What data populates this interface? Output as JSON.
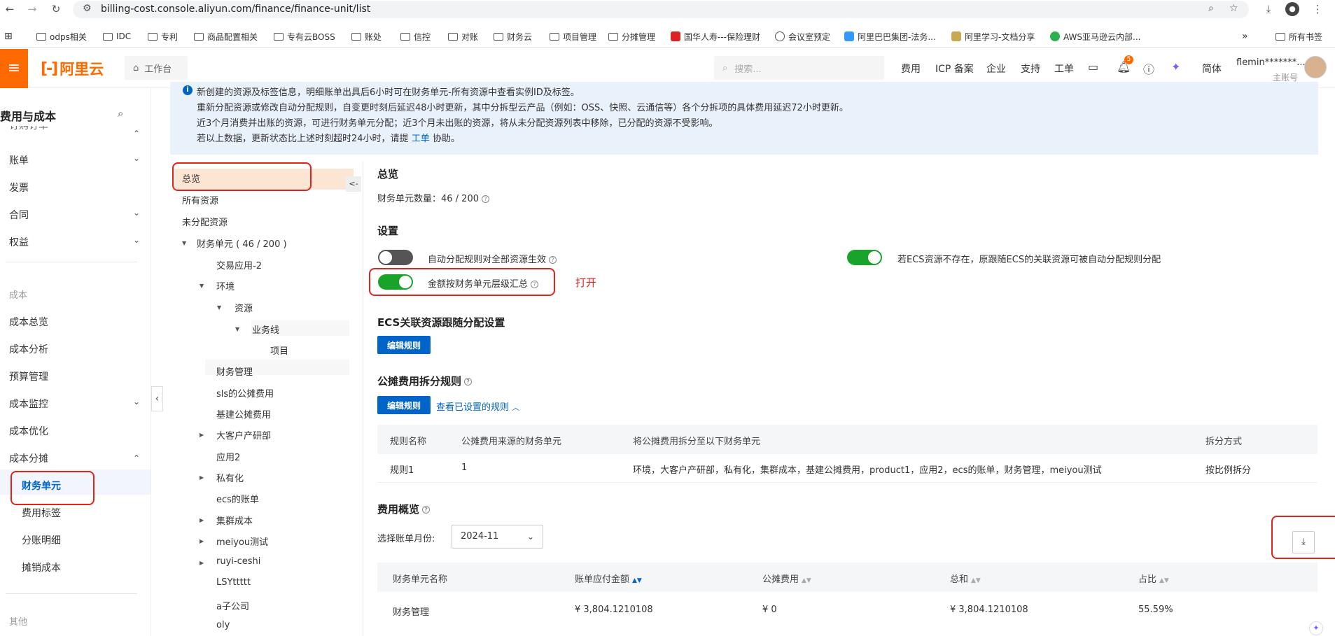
{
  "browser": {
    "url": "billing-cost.console.aliyun.com/finance/finance-unit/list",
    "bookmarks": [
      "odps相关",
      "IDC",
      "专利",
      "商品配置相关",
      "专有云BOSS",
      "账处",
      "信控",
      "对账",
      "财务云",
      "项目管理",
      "分摊管理",
      "国华人寿---保险理财",
      "会议室预定",
      "阿里巴巴集团-法务...",
      "阿里学习-文档分享",
      "AWS亚马逊云内部..."
    ],
    "all_bookmarks": "所有书签",
    "more": "»"
  },
  "topbar": {
    "logo_text": "阿里云",
    "workbench": "工作台",
    "search_placeholder": "搜索...",
    "nav": [
      "费用",
      "ICP 备案",
      "企业",
      "支持",
      "工单"
    ],
    "notif_count": "5",
    "lang": "简体",
    "username": "flemin*******...",
    "user_role": "主账号",
    "brand_color": "#ff6a00"
  },
  "sidebar": {
    "title": "费用与成本",
    "truncated_top": "订购订单",
    "items_top": [
      "账单",
      "发票",
      "合同",
      "权益"
    ],
    "group_cost": "成本",
    "items_cost": [
      "成本总览",
      "成本分析",
      "预算管理",
      "成本监控",
      "成本优化",
      "成本分摊"
    ],
    "sub_items": [
      "财务单元",
      "费用标签",
      "分账明细",
      "摊销成本"
    ],
    "group_other": "其他"
  },
  "notice": {
    "lines": [
      "新创建的资源及标签信息，明细账单出具后6小时可在财务单元-所有资源中查看实例ID及标签。",
      "重新分配资源或修改自动分配规则，自变更时刻后延迟48小时更新，其中分拆型云产品（例如：OSS、快照、云通信等）各个分拆项的具体费用延迟72小时更新。",
      "近3个月消费并出账的资源，可进行财务单元分配；近3个月未出账的资源，将从未分配资源列表中移除，已分配的资源不受影响。",
      "若以上数据，更新状态比上述时刻超时24小时，请提"
    ],
    "link": "工单",
    "tail": "协助。"
  },
  "tree": {
    "overview": "总览",
    "all_resources": "所有资源",
    "unallocated": "未分配资源",
    "root": "财务单元 ( 46 / 200 )",
    "nodes": [
      "交易应用-2",
      "环境",
      "资源",
      "业务线",
      "项目",
      "财务管理",
      "sls的公摊费用",
      "基建公摊费用",
      "大客户产研部",
      "应用2",
      "私有化",
      "ecs的账单",
      "集群成本",
      "meiyou测试",
      "ruyi-ceshi",
      "LSYttttt",
      "a子公司",
      "oly"
    ],
    "collapse": "<-"
  },
  "main": {
    "overview_title": "总览",
    "unit_count_label": "财务单元数量：46 / 200",
    "settings_title": "设置",
    "setting1": "自动分配规则对全部资源生效",
    "setting1_on": false,
    "setting2": "若ECS资源不存在，原跟随ECS的关联资源可被自动分配规则分配",
    "setting2_on": true,
    "setting3": "金额按财务单元层级汇总",
    "setting3_on": true,
    "annotation": "打开",
    "ecs_title": "ECS关联资源跟随分配设置",
    "edit_rule": "编辑规则",
    "split_title": "公摊费用拆分规则",
    "view_rules": "查看已设置的规则",
    "split_table": {
      "headers": [
        "规则名称",
        "公摊费用来源的财务单元",
        "将公摊费用拆分至以下财务单元",
        "拆分方式"
      ],
      "rows": [
        [
          "规则1",
          "1",
          "环境，大客户产研部，私有化，集群成本，基建公摊费用，product1，应用2，ecs的账单，财务管理，meiyou测试",
          "按比例拆分"
        ]
      ]
    },
    "cost_title": "费用概览",
    "month_label": "选择账单月份:",
    "month_value": "2024-11",
    "cost_table": {
      "headers": [
        "财务单元名称",
        "账单应付金额",
        "公摊费用",
        "总和",
        "占比"
      ],
      "rows": [
        [
          "财务管理",
          "¥ 3,804.1210108",
          "¥ 0",
          "¥ 3,804.1210108",
          "55.59%"
        ]
      ]
    }
  },
  "colors": {
    "accent": "#0064c8",
    "toggle_on": "#1aa32a",
    "toggle_off": "#555555",
    "highlight": "#e0231b"
  }
}
